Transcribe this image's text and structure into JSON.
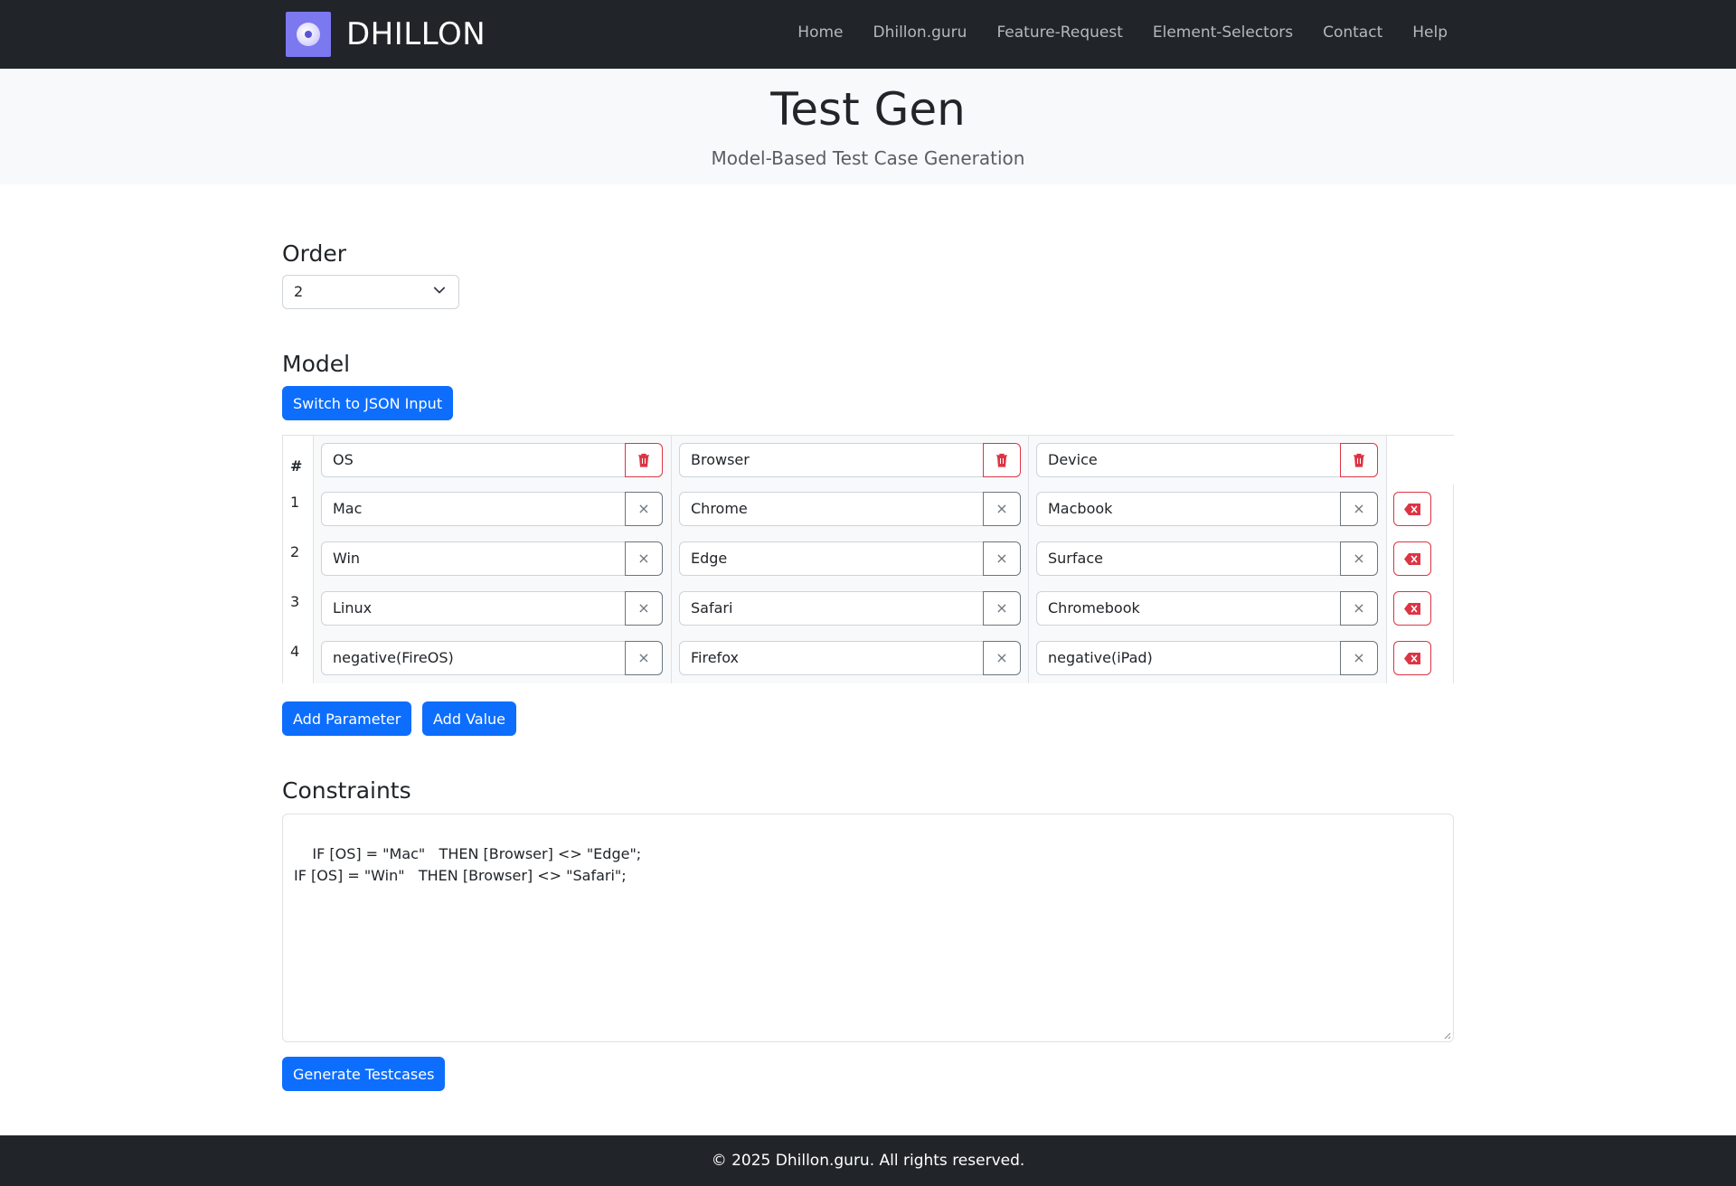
{
  "navbar": {
    "brand": "DHILLON",
    "links": [
      "Home",
      "Dhillon.guru",
      "Feature-Request",
      "Element-Selectors",
      "Contact",
      "Help"
    ]
  },
  "hero": {
    "title": "Test Gen",
    "subtitle": "Model-Based Test Case Generation"
  },
  "order": {
    "heading": "Order",
    "selected": "2"
  },
  "model": {
    "heading": "Model",
    "switch_label": "Switch to JSON Input",
    "index_header": "#",
    "parameters": [
      "OS",
      "Browser",
      "Device"
    ],
    "rows": [
      {
        "index": "1",
        "values": [
          "Mac",
          "Chrome",
          "Macbook"
        ]
      },
      {
        "index": "2",
        "values": [
          "Win",
          "Edge",
          "Surface"
        ]
      },
      {
        "index": "3",
        "values": [
          "Linux",
          "Safari",
          "Chromebook"
        ]
      },
      {
        "index": "4",
        "values": [
          "negative(FireOS)",
          "Firefox",
          "negative(iPad)"
        ]
      }
    ],
    "clear_symbol": "×",
    "add_parameter_label": "Add Parameter",
    "add_value_label": "Add Value"
  },
  "constraints": {
    "heading": "Constraints",
    "text": "IF [OS] = \"Mac\"   THEN [Browser] <> \"Edge\";\nIF [OS] = \"Win\"   THEN [Browser] <> \"Safari\";"
  },
  "generate_label": "Generate Testcases",
  "footer": "© 2025 Dhillon.guru. All rights reserved.",
  "colors": {
    "primary": "#0d6efd",
    "danger": "#dc3545",
    "dark": "#212529"
  }
}
